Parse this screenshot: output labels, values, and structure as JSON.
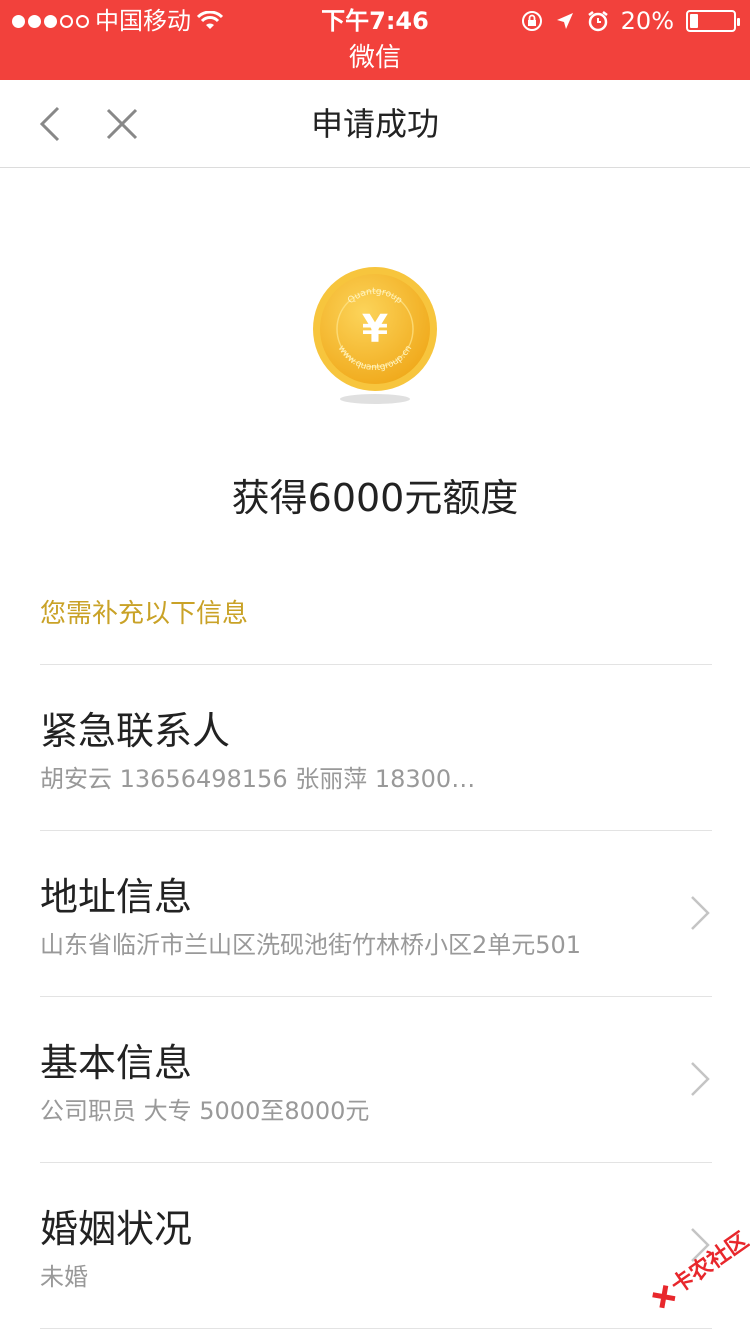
{
  "status_bar": {
    "carrier": "中国移动",
    "time": "下午7:46",
    "battery": "20%",
    "app_name": "微信",
    "signal_icon": "signal-dots-icon",
    "wifi_icon": "wifi-icon",
    "lock_icon": "orientation-lock-icon",
    "location_icon": "location-arrow-icon",
    "alarm_icon": "alarm-icon",
    "battery_level": 0.2
  },
  "nav": {
    "title": "申请成功",
    "back_icon": "chevron-left-icon",
    "close_icon": "close-icon"
  },
  "coin": {
    "symbol": "¥",
    "ring_text_top": "Quantgroup",
    "ring_text_bottom": "www.quantgroup.cn"
  },
  "headline": "获得6000元额度",
  "hint": "您需补充以下信息",
  "items": [
    {
      "title": "紧急联系人",
      "detail": "胡安云 13656498156 张丽萍 18300…",
      "has_chevron": false
    },
    {
      "title": "地址信息",
      "detail": "山东省临沂市兰山区洗砚池街竹林桥小区2单元501",
      "has_chevron": true
    },
    {
      "title": "基本信息",
      "detail": "公司职员 大专 5000至8000元",
      "has_chevron": true
    },
    {
      "title": "婚姻状况",
      "detail": "未婚",
      "has_chevron": true
    }
  ],
  "watermark": {
    "text": "卡农社区"
  },
  "colors": {
    "status_bar": "#f2413c",
    "hint": "#c9a227",
    "coin": "#f5b52a"
  }
}
